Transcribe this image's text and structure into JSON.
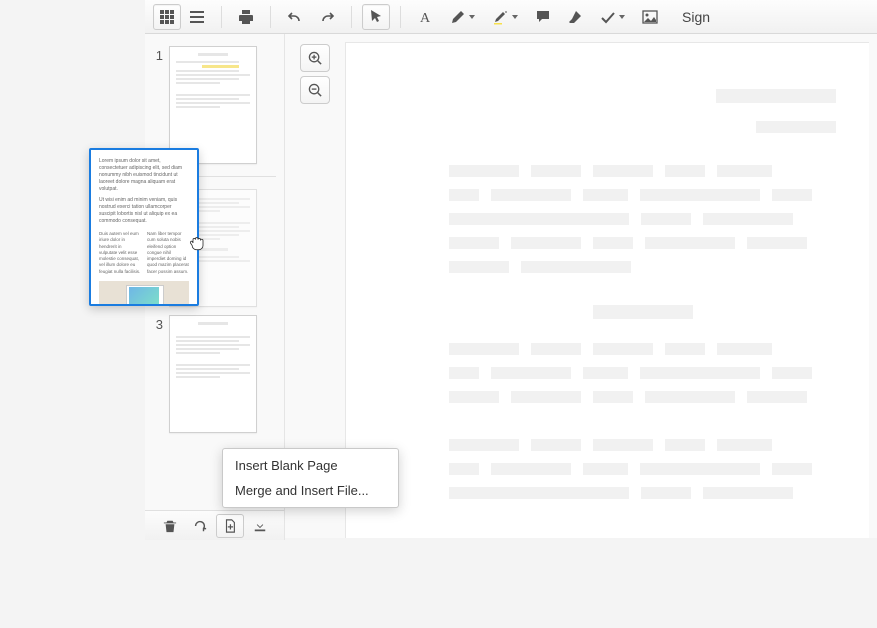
{
  "toolbar": {
    "sign_label": "Sign"
  },
  "icons": {
    "grid": "grid-icon",
    "list": "list-icon",
    "print": "print-icon",
    "undo": "undo-icon",
    "redo": "redo-icon",
    "pointer": "pointer-icon",
    "text": "text-icon",
    "pencil": "pencil-icon",
    "highlighter": "highlighter-icon",
    "comment": "comment-icon",
    "eraser": "eraser-icon",
    "check": "check-icon",
    "image": "image-icon",
    "zoom_in": "zoom-in-icon",
    "zoom_out": "zoom-out-icon",
    "trash": "trash-icon",
    "rotate": "rotate-icon",
    "add_page": "add-page-icon",
    "download": "download-icon"
  },
  "thumbnails": {
    "pages": [
      {
        "num": "1"
      },
      {
        "num": ""
      },
      {
        "num": "3"
      }
    ]
  },
  "dragged": {
    "para1": "Lorem ipsum dolor sit amet, consectetuer adipiscing elit, sed diam nonummy nibh euismod tincidunt ut laoreet dolore magna aliquam erat volutpat.",
    "para2": "Ut wisi enim ad minim veniam, quis nostrud exerci tation ullamcorper suscipit lobortis nisl ut aliquip ex ea commodo consequat.",
    "col1": "Duis autem vel eum iriure dolor in hendrerit in vulputate velit esse molestie consequat, vel illum dolore eu feugiat nulla facilisis.",
    "col2": "Nam liber tempor cum soluta nobis eleifend option congue nihil imperdiet doming id quod mazim placerat facer possim assum."
  },
  "context_menu": {
    "items": [
      {
        "label": "Insert Blank Page"
      },
      {
        "label": "Merge and Insert File..."
      }
    ]
  }
}
